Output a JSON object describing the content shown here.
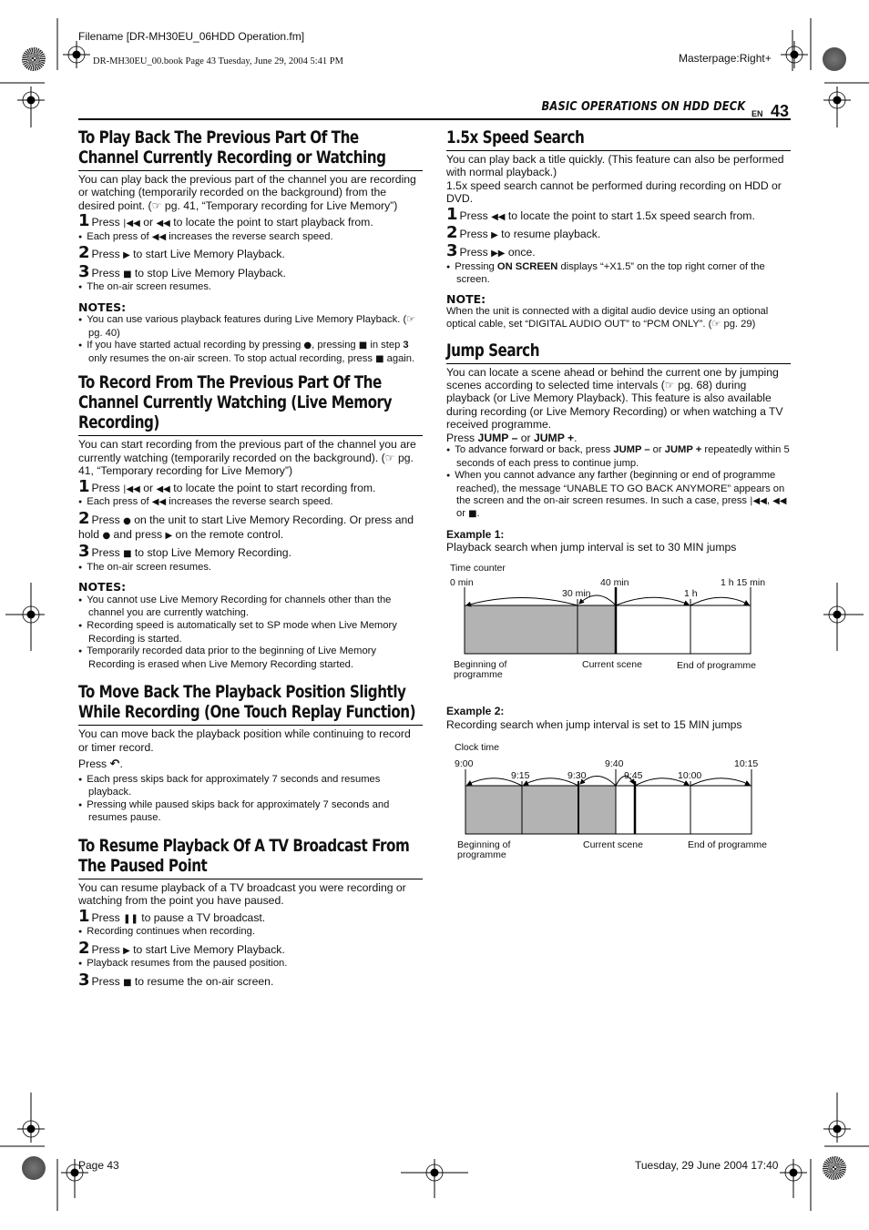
{
  "print_meta": {
    "filename": "Filename [DR-MH30EU_06HDD Operation.fm]",
    "book_line": "DR-MH30EU_00.book  Page 43  Tuesday, June 29, 2004  5:41 PM",
    "masterpage": "Masterpage:Right+",
    "footer_page": "Page 43",
    "footer_date": "Tuesday, 29 June 2004  17:40"
  },
  "header": {
    "running_head": "BASIC OPERATIONS ON HDD DECK",
    "lang": "EN",
    "page_number": "43"
  },
  "symbols": {
    "skip_back": "|◀◀",
    "rewind": "◀◀",
    "play": "▶",
    "stop": "■",
    "record": "●",
    "pause": "❚❚",
    "ffwd": "▶▶",
    "replay": "↶",
    "ref": "☞"
  },
  "left": {
    "s1": {
      "title": "To Play Back The Previous Part Of The Channel Currently Recording or Watching",
      "intro": "You can play back the previous part of the channel you are recording or watching (temporarily recorded on the background) from the desired point. (☞ pg. 41, “Temporary recording for Live Memory”)",
      "step1": {
        "num": "1",
        "a": "Press ",
        "b": " or ",
        "c": " to locate the point to start playback from."
      },
      "step1_bullet": {
        "a": "Each press of ",
        "b": " increases the reverse search speed."
      },
      "step2": {
        "num": "2",
        "a": "Press ",
        "b": " to start Live Memory Playback."
      },
      "step3": {
        "num": "3",
        "a": "Press ",
        "b": " to stop Live Memory Playback."
      },
      "step3_bullet": "The on-air screen resumes.",
      "notes_heading": "NOTES:",
      "note1": "You can use various playback features during Live Memory Playback. (☞ pg. 40)",
      "note2": {
        "a": "If you have started actual recording by pressing ",
        "b": ", pressing ",
        "c": " in step ",
        "d": "3",
        "e": " only resumes the on-air screen. To stop actual recording, press ",
        "f": " again."
      }
    },
    "s2": {
      "title": "To Record From The Previous Part Of The Channel Currently Watching (Live Memory Recording)",
      "intro": "You can start recording from the previous part of the channel you are currently watching (temporarily recorded on the background). (☞ pg. 41, “Temporary recording for Live Memory”)",
      "step1": {
        "num": "1",
        "a": "Press ",
        "b": " or ",
        "c": " to locate the point to start recording from."
      },
      "step1_bullet": {
        "a": "Each press of ",
        "b": " increases the reverse search speed."
      },
      "step2": {
        "num": "2",
        "a": "Press ",
        "b": " on the unit to start Live Memory Recording. Or press and hold ",
        "c": " and press ",
        "d": " on the remote control."
      },
      "step3": {
        "num": "3",
        "a": "Press ",
        "b": " to stop Live Memory Recording."
      },
      "step3_bullet": "The on-air screen resumes.",
      "notes_heading": "NOTES:",
      "notes": [
        "You cannot use Live Memory Recording for channels other than the channel you are currently watching.",
        "Recording speed is automatically set to SP mode when Live Memory Recording is started.",
        "Temporarily recorded data prior to the beginning of Live Memory Recording is erased when Live Memory Recording started."
      ]
    },
    "s3": {
      "title": "To Move Back The Playback Position Slightly While Recording (One Touch Replay Function)",
      "intro": "You can move back the playback position while continuing to record or timer record.",
      "press": "Press ",
      "bullets": [
        "Each press skips back for approximately 7 seconds and resumes playback.",
        "Pressing while paused skips back for approximately 7 seconds and resumes pause."
      ]
    },
    "s4": {
      "title": "To Resume Playback Of A TV Broadcast From The Paused Point",
      "intro": "You can resume playback of a TV broadcast you were recording or watching from the point you have paused.",
      "step1": {
        "num": "1",
        "a": "Press ",
        "b": " to pause a TV broadcast."
      },
      "step1_bullet": "Recording continues when recording.",
      "step2": {
        "num": "2",
        "a": "Press ",
        "b": " to start Live Memory Playback."
      },
      "step2_bullet": "Playback resumes from the paused position.",
      "step3": {
        "num": "3",
        "a": "Press ",
        "b": " to resume the on-air screen."
      }
    }
  },
  "right": {
    "s1": {
      "title": "1.5x Speed Search",
      "intro1": "You can play back a title quickly. (This feature can also be performed with normal playback.)",
      "intro2": "1.5x speed search cannot be performed during recording on HDD or DVD.",
      "step1": {
        "num": "1",
        "a": "Press ",
        "b": " to locate the point to start 1.5x speed search from."
      },
      "step2": {
        "num": "2",
        "a": "Press ",
        "b": " to resume playback."
      },
      "step3": {
        "num": "3",
        "a": "Press ",
        "b": " once."
      },
      "step3_bullet": {
        "a": "Pressing ",
        "b": "ON SCREEN",
        "c": " displays “+X1.5” on the top right corner of the screen."
      },
      "note_heading": "NOTE:",
      "note": "When the unit is connected with a digital audio device using an optional optical cable, set “DIGITAL AUDIO OUT” to “PCM ONLY”. (☞ pg. 29)"
    },
    "s2": {
      "title": "Jump Search",
      "intro": "You can locate a scene ahead or behind the current one by jumping scenes according to selected time intervals (☞ pg. 68) during playback (or Live Memory Playback). This feature is also available during recording (or Live Memory Recording) or when watching a TV received programme.",
      "press": {
        "a": "Press ",
        "b": "JUMP –",
        "c": " or ",
        "d": "JUMP +",
        "e": "."
      },
      "bullet1": {
        "a": "To advance forward or back, press ",
        "b": "JUMP –",
        "c": " or ",
        "d": "JUMP +",
        "e": " repeatedly within 5 seconds of each press to continue jump."
      },
      "bullet2": {
        "a": "When you cannot advance any farther (beginning or end of programme reached), the message “UNABLE TO GO BACK ANYMORE” appears on the screen and the on-air screen resumes. In such a case, press ",
        "b": ", ",
        "c": " or ",
        "d": "."
      },
      "example1": {
        "heading": "Example 1:",
        "caption": "Playback search when jump interval is set to 30 MIN jumps",
        "axis_title": "Time counter",
        "start_label": "0 min",
        "current_label": "40 min",
        "end_label": "1 h 15 min",
        "jump_labels": [
          "30 min",
          "1 h"
        ],
        "bottom_labels": {
          "begin": "Beginning of programme",
          "current": "Current scene",
          "end": "End of programme"
        }
      },
      "example2": {
        "heading": "Example 2:",
        "caption": "Recording search when jump interval is set to 15 MIN jumps",
        "axis_title": "Clock time",
        "start_label": "9:00",
        "current_label": "9:40",
        "end_label": "10:15",
        "jump_labels": [
          "9:15",
          "9:30",
          "9:45",
          "10:00"
        ],
        "bottom_labels": {
          "begin": "Beginning of programme",
          "current": "Current scene",
          "end": "End of programme"
        }
      }
    }
  }
}
